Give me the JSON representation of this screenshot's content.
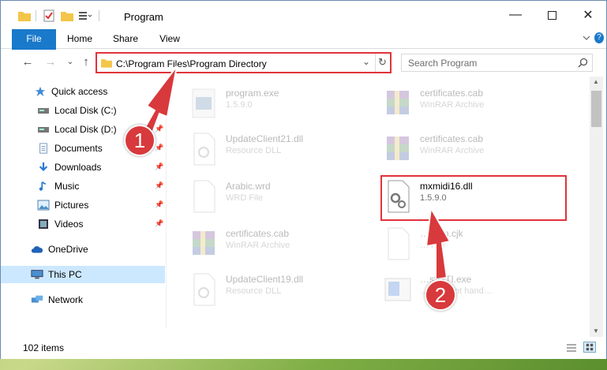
{
  "window": {
    "title": "Program"
  },
  "ribbon": {
    "tabs": [
      "File",
      "Home",
      "Share",
      "View"
    ]
  },
  "address": {
    "path": "C:\\Program Files\\Program Directory"
  },
  "search": {
    "placeholder": "Search Program"
  },
  "sidebar": {
    "items": [
      {
        "label": "Quick access",
        "icon": "star-icon"
      },
      {
        "label": "Local Disk (C:)",
        "icon": "drive-icon",
        "pinned": true
      },
      {
        "label": "Local Disk (D:)",
        "icon": "drive-icon",
        "pinned": true
      },
      {
        "label": "Documents",
        "icon": "documents-icon",
        "pinned": true
      },
      {
        "label": "Downloads",
        "icon": "downloads-icon",
        "pinned": true
      },
      {
        "label": "Music",
        "icon": "music-icon",
        "pinned": true
      },
      {
        "label": "Pictures",
        "icon": "pictures-icon",
        "pinned": true
      },
      {
        "label": "Videos",
        "icon": "videos-icon",
        "pinned": true
      },
      {
        "label": "OneDrive",
        "icon": "onedrive-icon"
      },
      {
        "label": "This PC",
        "icon": "computer-icon",
        "selected": true
      },
      {
        "label": "Network",
        "icon": "network-icon"
      }
    ]
  },
  "files": [
    {
      "name": "program.exe",
      "type": "1.5.9.0",
      "icon": "exe-icon"
    },
    {
      "name": "certificates.cab",
      "type": "WinRAR Archive",
      "icon": "winrar-icon"
    },
    {
      "name": "UpdateClient21.dll",
      "type": "Resource DLL",
      "icon": "dll-icon"
    },
    {
      "name": "certificates.cab",
      "type": "WinRAR Archive",
      "icon": "winrar-icon"
    },
    {
      "name": "Arabic.wrd",
      "type": "WRD File",
      "icon": "blank-file-icon"
    },
    {
      "name": "mxmidi16.dll",
      "type": "1.5.9.0",
      "icon": "dll-gear-icon",
      "highlighted": true
    },
    {
      "name": "certificates.cab",
      "type": "WinRAR Archive",
      "icon": "winrar-icon"
    },
    {
      "name": "…Kom.cjk",
      "type": "… File",
      "icon": "blank-file-icon"
    },
    {
      "name": "UpdateClient19.dll",
      "type": "Resource DLL",
      "icon": "dll-icon"
    },
    {
      "name": "…sySTI.exe",
      "type": "…ab event hand…",
      "icon": "exe-icon"
    }
  ],
  "status": {
    "count": "102 items"
  },
  "callouts": [
    "1",
    "2"
  ],
  "colors": {
    "accent": "#1979ca",
    "highlight": "#e0333b",
    "selected": "#cce8ff"
  }
}
